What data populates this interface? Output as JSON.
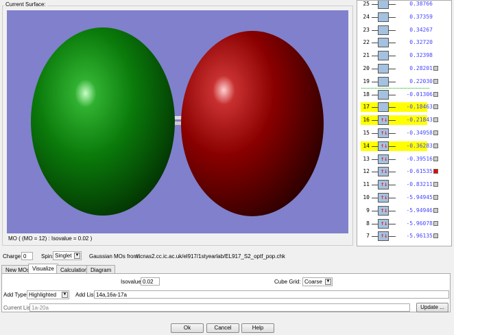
{
  "surface": {
    "label": "Current Surface:",
    "caption": "MO ( (MO = 12) : Isovalue = 0.02 )"
  },
  "orbital_colors": {
    "positive": "#0a7a0a",
    "negative": "#8a0000",
    "background": "#8080cc"
  },
  "mo_list": [
    {
      "n": "25",
      "e": "0.38766",
      "occ": 0,
      "hl": false,
      "chk": null
    },
    {
      "n": "24",
      "e": "0.37359",
      "occ": 0,
      "hl": false,
      "chk": null
    },
    {
      "n": "23",
      "e": "0.34267",
      "occ": 0,
      "hl": false,
      "chk": null
    },
    {
      "n": "22",
      "e": "0.32720",
      "occ": 0,
      "hl": false,
      "chk": null
    },
    {
      "n": "21",
      "e": "0.32398",
      "occ": 0,
      "hl": false,
      "chk": null
    },
    {
      "n": "20",
      "e": "0.28201",
      "occ": 0,
      "hl": false,
      "chk": "off"
    },
    {
      "n": "19",
      "e": "0.22030",
      "occ": 0,
      "hl": false,
      "chk": "off"
    },
    {
      "n": "18",
      "e": "-0.01306",
      "occ": 0,
      "hl": false,
      "chk": "off"
    },
    {
      "n": "17",
      "e": "-0.18463",
      "occ": 0,
      "hl": true,
      "chk": "off"
    },
    {
      "n": "16",
      "e": "-0.21843",
      "occ": 2,
      "hl": true,
      "chk": "off"
    },
    {
      "n": "15",
      "e": "-0.34958",
      "occ": 2,
      "hl": false,
      "chk": "off"
    },
    {
      "n": "14",
      "e": "-0.36283",
      "occ": 2,
      "hl": true,
      "chk": "off"
    },
    {
      "n": "13",
      "e": "-0.39516",
      "occ": 2,
      "hl": false,
      "chk": "off"
    },
    {
      "n": "12",
      "e": "-0.61535",
      "occ": 2,
      "hl": false,
      "chk": "on"
    },
    {
      "n": "11",
      "e": "-0.83211",
      "occ": 2,
      "hl": false,
      "chk": "off"
    },
    {
      "n": "10",
      "e": "-5.94945",
      "occ": 2,
      "hl": false,
      "chk": "off"
    },
    {
      "n": "9",
      "e": "-5.94946",
      "occ": 2,
      "hl": false,
      "chk": "off"
    },
    {
      "n": "8",
      "e": "-5.96078",
      "occ": 2,
      "hl": false,
      "chk": "off"
    },
    {
      "n": "7",
      "e": "-5.96135",
      "occ": 2,
      "hl": false,
      "chk": "off"
    }
  ],
  "controls": {
    "charge_label": "Charge:",
    "charge": "0",
    "spin_label": "Spin:",
    "spin": "Singlet",
    "source_label": "Gaussian MOs from:",
    "source": "//icnas2.cc.ic.ac.uk/el917/1styearlab/EL917_S2_optf_pop.chk"
  },
  "tabs": [
    "New MOs",
    "Visualize",
    "Calculation",
    "Diagram"
  ],
  "visualize": {
    "isovalue_label": "Isovalue:",
    "isovalue": "0.02",
    "cube_label": "Cube Grid:",
    "cube": "Coarse",
    "add_type_label": "Add Type:",
    "add_type": "Highlighted",
    "add_list_label": "Add List:",
    "add_list": "14a,16a-17a",
    "current_list_label": "Current List:",
    "current_list": "1a-20a",
    "update": "Update ..."
  },
  "buttons": {
    "ok": "Ok",
    "cancel": "Cancel",
    "help": "Help"
  }
}
